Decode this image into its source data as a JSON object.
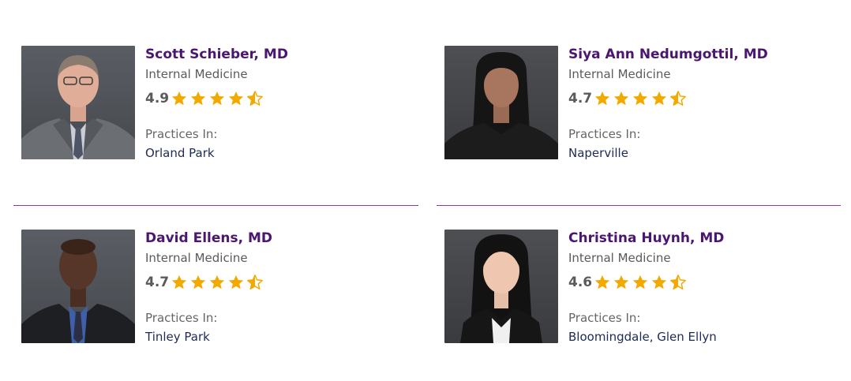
{
  "colors": {
    "name": "#4a1670",
    "star": "#f2a900",
    "divider": "#8c3a9a",
    "location": "#1d2b55"
  },
  "doctors": [
    {
      "name": "Scott Schieber, MD",
      "specialty": "Internal Medicine",
      "rating": "4.9",
      "rating_value": 4.9,
      "stars": [
        "full",
        "full",
        "full",
        "full",
        "half"
      ],
      "practices_label": "Practices In:",
      "location": "Orland Park"
    },
    {
      "name": "Siya Ann Nedumgottil, MD",
      "specialty": "Internal Medicine",
      "rating": "4.7",
      "rating_value": 4.7,
      "stars": [
        "full",
        "full",
        "full",
        "full",
        "half"
      ],
      "practices_label": "Practices In:",
      "location": "Naperville"
    },
    {
      "name": "David Ellens, MD",
      "specialty": "Internal Medicine",
      "rating": "4.7",
      "rating_value": 4.7,
      "stars": [
        "full",
        "full",
        "full",
        "full",
        "half"
      ],
      "practices_label": "Practices In:",
      "location": "Tinley Park"
    },
    {
      "name": "Christina Huynh, MD",
      "specialty": "Internal Medicine",
      "rating": "4.6",
      "rating_value": 4.6,
      "stars": [
        "full",
        "full",
        "full",
        "full",
        "half"
      ],
      "practices_label": "Practices In:",
      "location": "Bloomingdale, Glen Ellyn"
    }
  ]
}
